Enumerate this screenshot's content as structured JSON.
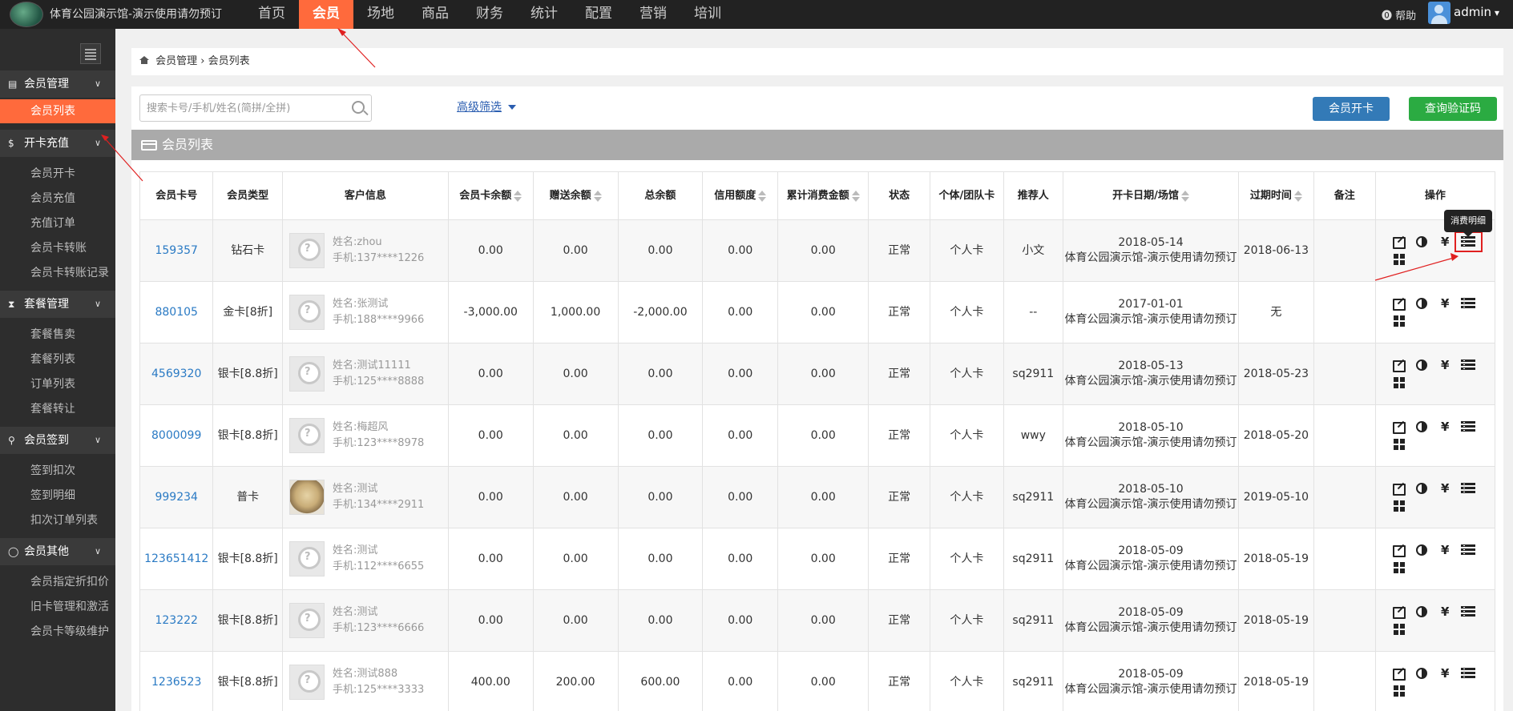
{
  "header": {
    "site_title": "体育公园演示馆-演示使用请勿预订",
    "nav": [
      "首页",
      "会员",
      "场地",
      "商品",
      "财务",
      "统计",
      "配置",
      "营销",
      "培训"
    ],
    "active_nav": 1,
    "help": "帮助",
    "user": "admin"
  },
  "sidebar": {
    "sections": [
      {
        "label": "会员管理",
        "icon": "id-card-icon",
        "items": [
          "会员列表"
        ]
      },
      {
        "label": "开卡充值",
        "icon": "dollar-icon",
        "items": [
          "会员开卡",
          "会员充值",
          "充值订单",
          "会员卡转账",
          "会员卡转账记录"
        ]
      },
      {
        "label": "套餐管理",
        "icon": "hourglass-icon",
        "items": [
          "套餐售卖",
          "套餐列表",
          "订单列表",
          "套餐转让"
        ]
      },
      {
        "label": "会员签到",
        "icon": "map-pin-icon",
        "items": [
          "签到扣次",
          "签到明细",
          "扣次订单列表"
        ]
      },
      {
        "label": "会员其他",
        "icon": "circle-icon",
        "items": [
          "会员指定折扣价",
          "旧卡管理和激活",
          "会员卡等级维护"
        ]
      }
    ],
    "active_item": "会员列表"
  },
  "breadcrumb": {
    "parent": "会员管理",
    "separator": "›",
    "current": "会员列表"
  },
  "toolbar": {
    "search_placeholder": "搜索卡号/手机/姓名(简拼/全拼)",
    "advanced_filter": "高级筛选",
    "open_card_button": "会员开卡",
    "verify_code_button": "查询验证码"
  },
  "list_title": "会员列表",
  "table": {
    "columns": [
      "会员卡号",
      "会员类型",
      "客户信息",
      "会员卡余额",
      "赠送余额",
      "总余额",
      "信用额度",
      "累计消费金额",
      "状态",
      "个体/团队卡",
      "推荐人",
      "开卡日期/场馆",
      "过期时间",
      "备注",
      "操作"
    ],
    "name_prefix": "姓名:",
    "phone_prefix": "手机:",
    "rows": [
      {
        "card": "159357",
        "type": "钻石卡",
        "name": "zhou",
        "phone": "137****1226",
        "balance": "0.00",
        "gift": "0.00",
        "total": "0.00",
        "credit": "0.00",
        "spent": "0.00",
        "status": "正常",
        "kind": "个人卡",
        "referrer": "小文",
        "open_date": "2018-05-14",
        "venue": "体育公园演示馆-演示使用请勿预订",
        "expire": "2018-06-13",
        "note": ""
      },
      {
        "card": "880105",
        "type": "金卡[8折]",
        "name": "张测试",
        "phone": "188****9966",
        "balance": "-3,000.00",
        "gift": "1,000.00",
        "total": "-2,000.00",
        "credit": "0.00",
        "spent": "0.00",
        "status": "正常",
        "kind": "个人卡",
        "referrer": "--",
        "open_date": "2017-01-01",
        "venue": "体育公园演示馆-演示使用请勿预订",
        "expire": "无",
        "note": ""
      },
      {
        "card": "4569320",
        "type": "银卡[8.8折]",
        "name": "测试11111",
        "phone": "125****8888",
        "balance": "0.00",
        "gift": "0.00",
        "total": "0.00",
        "credit": "0.00",
        "spent": "0.00",
        "status": "正常",
        "kind": "个人卡",
        "referrer": "sq2911",
        "open_date": "2018-05-13",
        "venue": "体育公园演示馆-演示使用请勿预订",
        "expire": "2018-05-23",
        "note": ""
      },
      {
        "card": "8000099",
        "type": "银卡[8.8折]",
        "name": "梅超风",
        "phone": "123****8978",
        "balance": "0.00",
        "gift": "0.00",
        "total": "0.00",
        "credit": "0.00",
        "spent": "0.00",
        "status": "正常",
        "kind": "个人卡",
        "referrer": "wwy",
        "open_date": "2018-05-10",
        "venue": "体育公园演示馆-演示使用请勿预订",
        "expire": "2018-05-20",
        "note": ""
      },
      {
        "card": "999234",
        "type": "普卡",
        "name": "测试",
        "phone": "134****2911",
        "balance": "0.00",
        "gift": "0.00",
        "total": "0.00",
        "credit": "0.00",
        "spent": "0.00",
        "status": "正常",
        "kind": "个人卡",
        "referrer": "sq2911",
        "open_date": "2018-05-10",
        "venue": "体育公园演示馆-演示使用请勿预订",
        "expire": "2019-05-10",
        "note": "",
        "photo": true
      },
      {
        "card": "123651412",
        "type": "银卡[8.8折]",
        "name": "测试",
        "phone": "112****6655",
        "balance": "0.00",
        "gift": "0.00",
        "total": "0.00",
        "credit": "0.00",
        "spent": "0.00",
        "status": "正常",
        "kind": "个人卡",
        "referrer": "sq2911",
        "open_date": "2018-05-09",
        "venue": "体育公园演示馆-演示使用请勿预订",
        "expire": "2018-05-19",
        "note": ""
      },
      {
        "card": "123222",
        "type": "银卡[8.8折]",
        "name": "测试",
        "phone": "123****6666",
        "balance": "0.00",
        "gift": "0.00",
        "total": "0.00",
        "credit": "0.00",
        "spent": "0.00",
        "status": "正常",
        "kind": "个人卡",
        "referrer": "sq2911",
        "open_date": "2018-05-09",
        "venue": "体育公园演示馆-演示使用请勿预订",
        "expire": "2018-05-19",
        "note": ""
      },
      {
        "card": "1236523",
        "type": "银卡[8.8折]",
        "name": "测试888",
        "phone": "125****3333",
        "balance": "400.00",
        "gift": "200.00",
        "total": "600.00",
        "credit": "0.00",
        "spent": "0.00",
        "status": "正常",
        "kind": "个人卡",
        "referrer": "sq2911",
        "open_date": "2018-05-09",
        "venue": "体育公园演示馆-演示使用请勿预订",
        "expire": "2018-05-19",
        "note": ""
      }
    ]
  },
  "operations": {
    "yen_symbol": "¥",
    "icons": [
      "edit-icon",
      "contrast-icon",
      "yen-icon",
      "list-icon",
      "grid-icon"
    ]
  },
  "tooltip": "消费明细",
  "colors": {
    "accent": "#ff6a3c",
    "topbar": "#222222",
    "sidebar": "#2d2d2d",
    "primary_button": "#337ab7",
    "success_button": "#2bab42",
    "link": "#2a7ac4",
    "annotation": "#e02020"
  }
}
